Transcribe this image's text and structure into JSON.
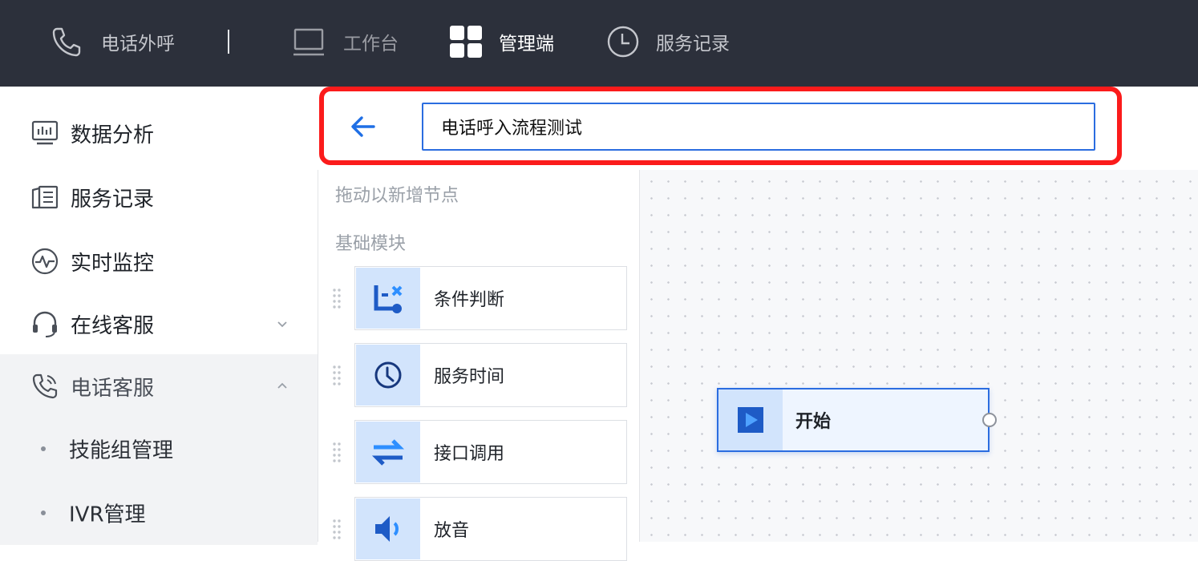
{
  "topnav": {
    "items": [
      {
        "label": "电话外呼",
        "icon": "phone-icon"
      },
      {
        "label": "工作台",
        "icon": "monitor-icon"
      },
      {
        "label": "管理端",
        "icon": "grid-icon",
        "active": true
      },
      {
        "label": "服务记录",
        "icon": "clock-icon"
      }
    ]
  },
  "sidebar": {
    "items": [
      {
        "label": "数据分析",
        "icon": "dashboard-icon"
      },
      {
        "label": "服务记录",
        "icon": "records-icon"
      },
      {
        "label": "实时监控",
        "icon": "pulse-icon"
      },
      {
        "label": "在线客服",
        "icon": "headset-icon",
        "chevron": "down"
      },
      {
        "label": "电话客服",
        "icon": "phone-icon",
        "chevron": "up"
      }
    ],
    "subitems": [
      {
        "label": "技能组管理"
      },
      {
        "label": "IVR管理"
      }
    ]
  },
  "editor": {
    "flow_name": "电话呼入流程测试"
  },
  "palette": {
    "hint": "拖动以新增节点",
    "group_title": "基础模块",
    "nodes": [
      {
        "label": "条件判断",
        "icon": "condition-icon"
      },
      {
        "label": "服务时间",
        "icon": "clock-icon"
      },
      {
        "label": "接口调用",
        "icon": "swap-icon"
      },
      {
        "label": "放音",
        "icon": "speaker-icon"
      }
    ]
  },
  "canvas": {
    "start_node": {
      "label": "开始",
      "icon": "play-icon"
    }
  },
  "colors": {
    "topbar": "#2c303b",
    "accent": "#2b6de0",
    "highlight": "#fb1b1b",
    "node_icon_bg": "#d2e4fc",
    "icon_blue": "#1e5bc6"
  }
}
